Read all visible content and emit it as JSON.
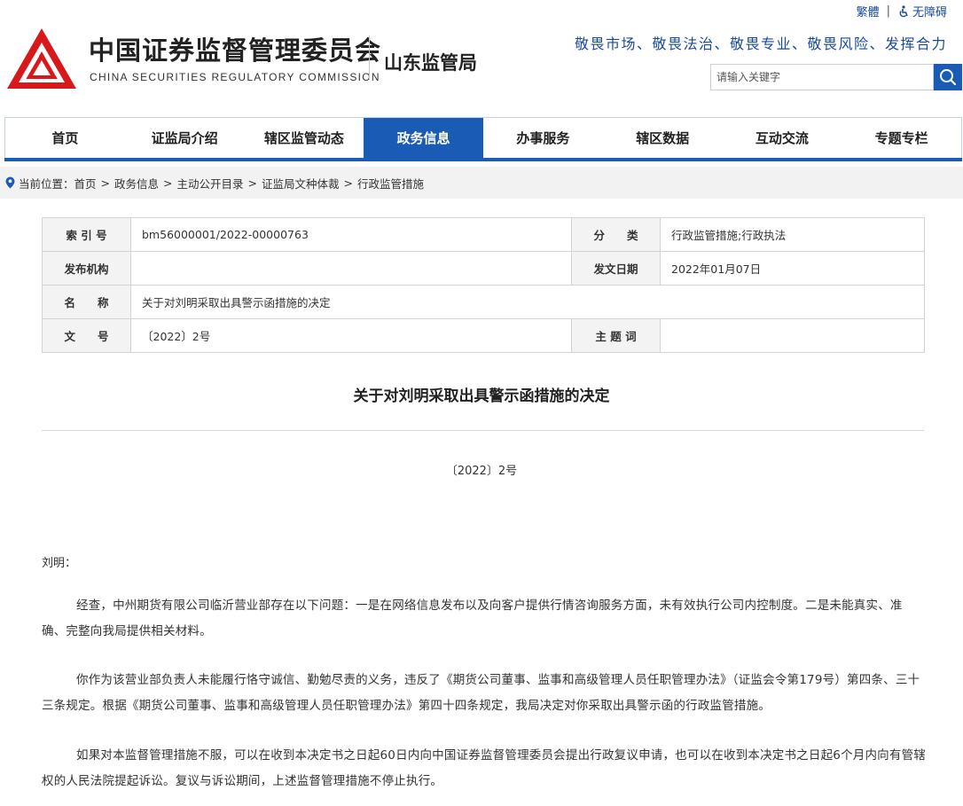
{
  "topbar": {
    "traditional": "繁體",
    "separator": "|",
    "accessibility": "无障碍"
  },
  "logo": {
    "name_cn": "中国证券监督管理委员会",
    "name_en": "CHINA SECURITIES REGULATORY COMMISSION",
    "emblem_color": "#d7191c"
  },
  "bureau": "山东监管局",
  "slogan": "敬畏市场、敬畏法治、敬畏专业、敬畏风险、发挥合力",
  "search": {
    "placeholder": "请输入关键字",
    "icon": "search-icon"
  },
  "nav": {
    "accent": "#1a5cb5",
    "items": [
      {
        "label": "首页"
      },
      {
        "label": "证监局介绍"
      },
      {
        "label": "辖区监管动态"
      },
      {
        "label": "政务信息",
        "active": true
      },
      {
        "label": "办事服务"
      },
      {
        "label": "辖区数据"
      },
      {
        "label": "互动交流"
      },
      {
        "label": "专题专栏"
      }
    ]
  },
  "breadcrumb": {
    "prefix": "当前位置：",
    "sep": ">",
    "items": [
      "首页",
      "政务信息",
      "主动公开目录",
      "证监局文种体裁",
      "行政监管措施"
    ]
  },
  "info": {
    "index_label": "索 引 号",
    "index_value": "bm56000001/2022-00000763",
    "category_label": "分　　类",
    "category_value": "行政监管措施;行政执法",
    "issuer_label": "发布机构",
    "issuer_value": "",
    "date_label": "发文日期",
    "date_value": "2022年01月07日",
    "name_label": "名　　称",
    "name_value": "关于对刘明采取出具警示函措施的决定",
    "docno_label": "文　　号",
    "docno_value": "〔2022〕2号",
    "keywords_label": "主 题 词",
    "keywords_value": ""
  },
  "article": {
    "title": "关于对刘明采取出具警示函措施的决定",
    "doc_number": "〔2022〕2号",
    "salutation": "刘明：",
    "paragraphs": [
      "经查，中州期货有限公司临沂营业部存在以下问题：一是在网络信息发布以及向客户提供行情咨询服务方面，未有效执行公司内控制度。二是未能真实、准确、完整向我局提供相关材料。",
      "你作为该营业部负责人未能履行恪守诚信、勤勉尽责的义务，违反了《期货公司董事、监事和高级管理人员任职管理办法》（证监会令第179号）第四条、三十三条规定。根据《期货公司董事、监事和高级管理人员任职管理办法》第四十四条规定，我局决定对你采取出具警示函的行政监管措施。",
      "如果对本监督管理措施不服，可以在收到本决定书之日起60日内向中国证券监督管理委员会提出行政复议申请，也可以在收到本决定书之日起6个月内向有管辖权的人民法院提起诉讼。复议与诉讼期间，上述监督管理措施不停止执行。"
    ]
  }
}
